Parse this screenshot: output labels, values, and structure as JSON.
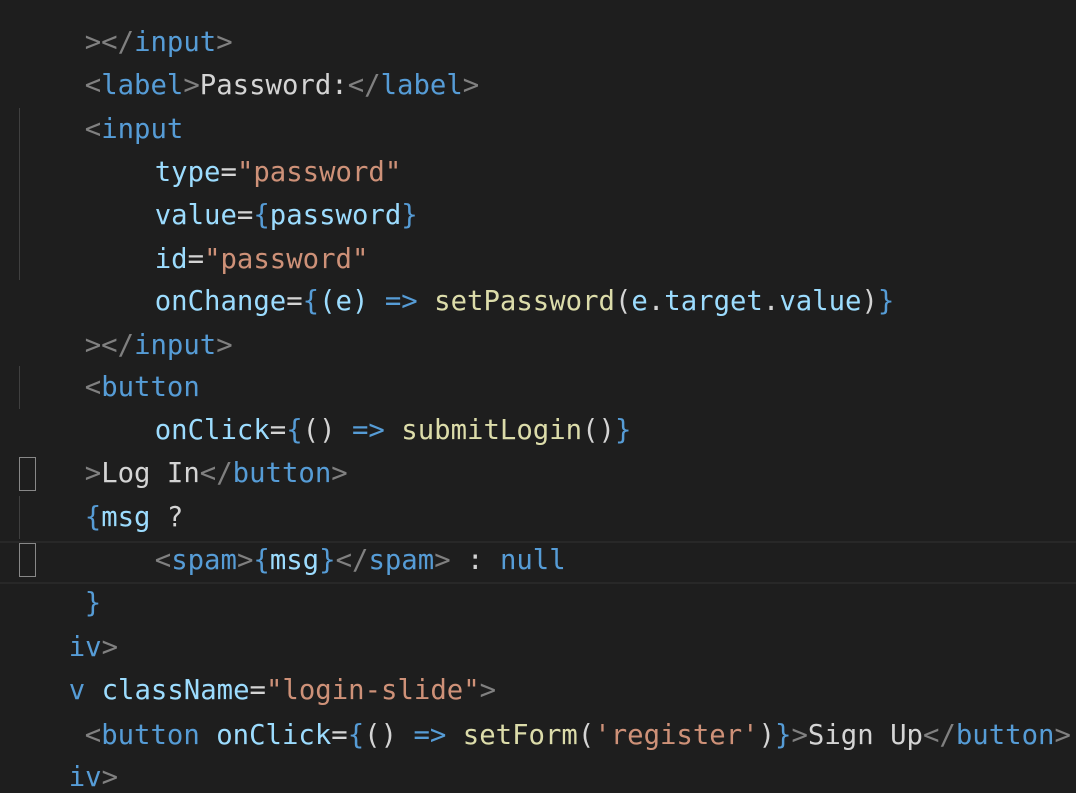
{
  "lines": [
    {
      "parts": [
        "></",
        "input",
        ">"
      ]
    },
    {
      "parts": [
        "<",
        "label",
        ">",
        "Password:",
        "</",
        "label",
        ">"
      ]
    },
    {
      "parts": [
        "<",
        "input"
      ]
    },
    {
      "parts": [
        "type",
        "=",
        "\"password\""
      ]
    },
    {
      "parts": [
        "value",
        "=",
        "{",
        "password",
        "}"
      ]
    },
    {
      "parts": [
        "id",
        "=",
        "\"password\""
      ]
    },
    {
      "parts": [
        "onChange",
        "=",
        "{",
        "(e)",
        " => ",
        "setPassword",
        "(",
        "e",
        ".",
        "target",
        ".",
        "value",
        ")",
        "}"
      ]
    },
    {
      "parts": [
        "></",
        "input",
        ">"
      ]
    },
    {
      "parts": [
        "<",
        "button"
      ]
    },
    {
      "parts": [
        "onClick",
        "=",
        "{",
        "()",
        " => ",
        "submitLogin",
        "()",
        "}"
      ]
    },
    {
      "parts": [
        ">",
        "Log In",
        "</",
        "button",
        ">"
      ]
    },
    {
      "parts": [
        "{",
        "msg",
        " ?"
      ]
    },
    {
      "parts": [
        "<",
        "spam",
        ">",
        "{",
        "msg",
        "}",
        "</",
        "spam",
        ">",
        " : ",
        "null"
      ]
    },
    {
      "parts": [
        "}"
      ]
    },
    {
      "parts": [
        "iv",
        ">"
      ]
    },
    {
      "parts": [
        "v ",
        "className",
        "=",
        "\"login-slide\"",
        ">"
      ]
    },
    {
      "parts": [
        "<",
        "button",
        " ",
        "onClick",
        "=",
        "{",
        "()",
        " => ",
        "setForm",
        "(",
        "'register'",
        ")",
        "}",
        ">",
        "Sign Up",
        "</",
        "button",
        ">"
      ]
    },
    {
      "parts": [
        "iv",
        ">"
      ]
    }
  ]
}
